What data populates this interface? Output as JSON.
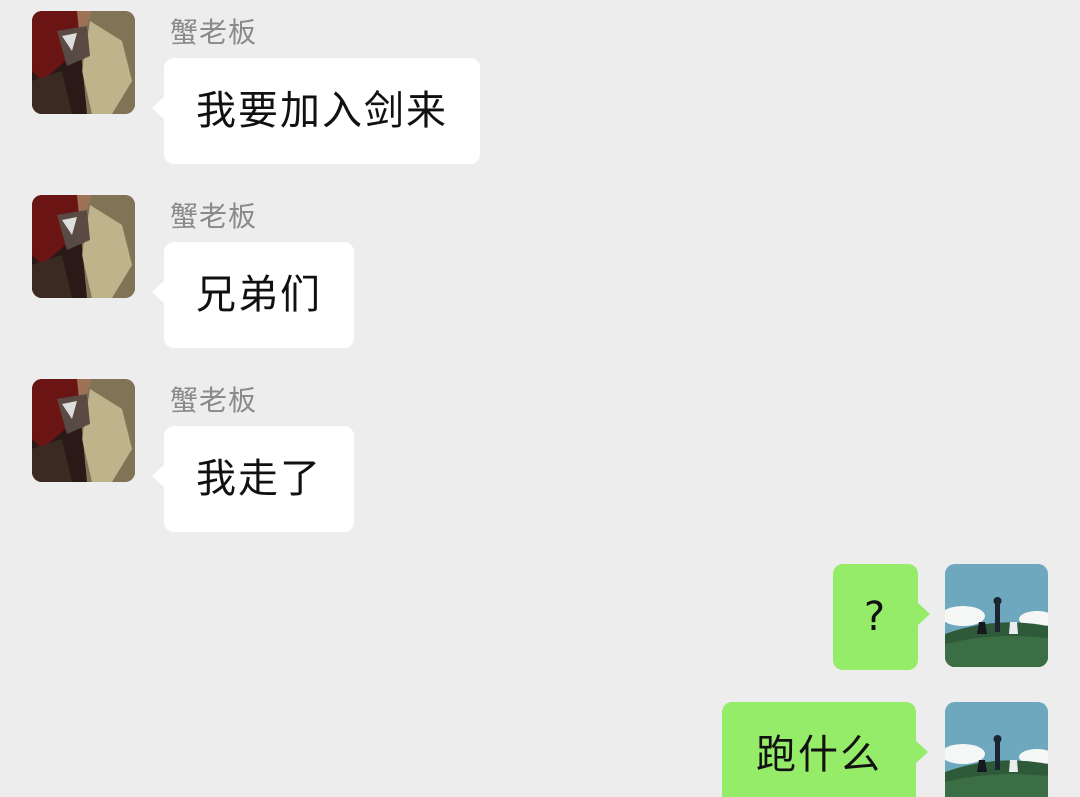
{
  "messages": [
    {
      "direction": "incoming",
      "sender": "蟹老板",
      "text": "我要加入剑来",
      "avatar": "dark-red-anime-character-avatar"
    },
    {
      "direction": "incoming",
      "sender": "蟹老板",
      "text": "兄弟们",
      "avatar": "dark-red-anime-character-avatar"
    },
    {
      "direction": "incoming",
      "sender": "蟹老板",
      "text": "我走了",
      "avatar": "dark-red-anime-character-avatar"
    },
    {
      "direction": "outgoing",
      "text": "?",
      "avatar": "sky-meadow-silhouette-avatar"
    },
    {
      "direction": "outgoing",
      "text": "跑什么",
      "avatar": "sky-meadow-silhouette-avatar"
    }
  ],
  "colors": {
    "background": "#ededed",
    "incoming_bubble": "#ffffff",
    "outgoing_bubble": "#95ec69",
    "sender_name": "#8a8a8a"
  }
}
